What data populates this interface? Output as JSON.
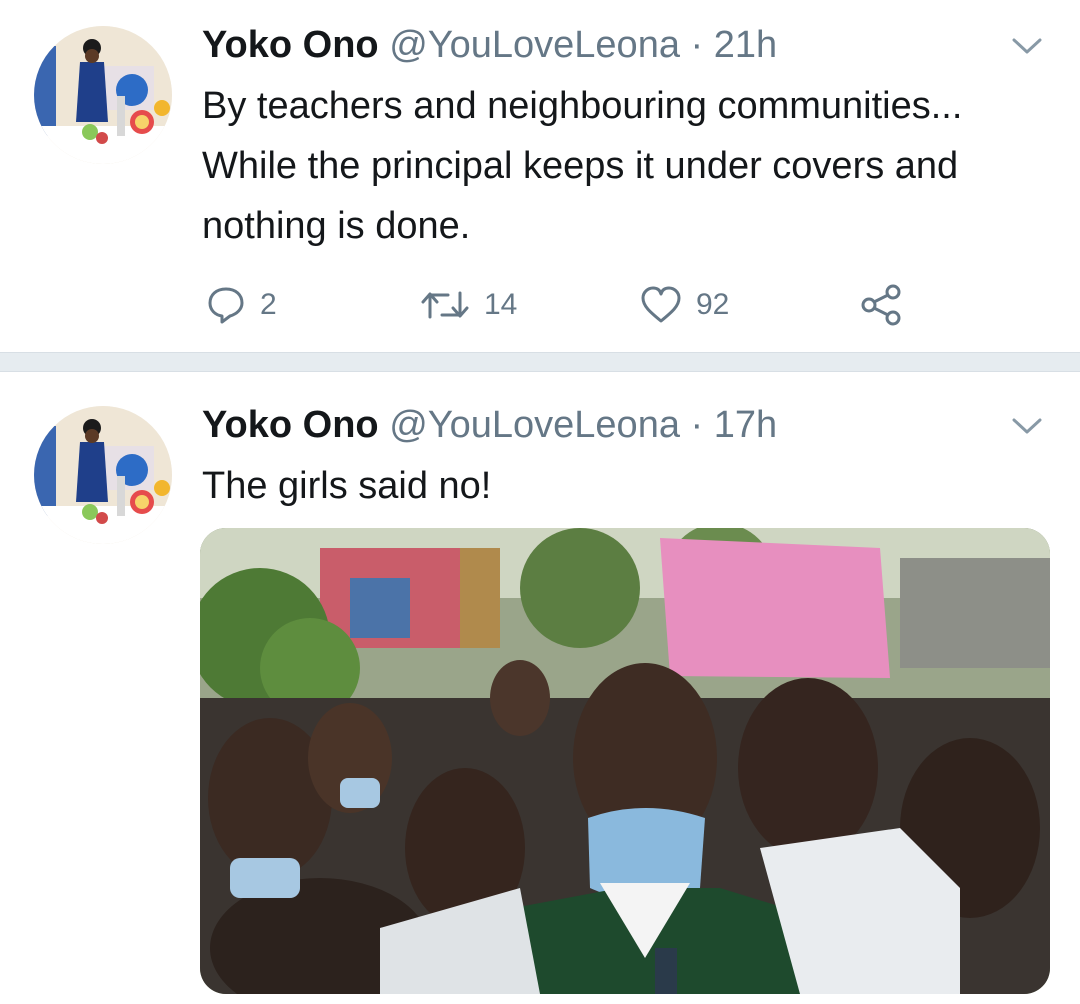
{
  "tweets": [
    {
      "name": "Yoko Ono",
      "handle": "@YouLoveLeona",
      "separator": "·",
      "time": "21h",
      "text": "By teachers and neighbouring communities... While the principal keeps it under covers and nothing is done.",
      "actions": {
        "replies": "2",
        "retweets": "14",
        "likes": "92"
      },
      "avatar_icon": "profile-photo"
    },
    {
      "name": "Yoko Ono",
      "handle": "@YouLoveLeona",
      "separator": "·",
      "time": "17h",
      "text": "The girls said no!",
      "media_icon": "video-photo-crowd-of-students"
    }
  ],
  "colors": {
    "text": "#14171a",
    "secondary": "#657786",
    "divider": "#e6ecf0"
  }
}
